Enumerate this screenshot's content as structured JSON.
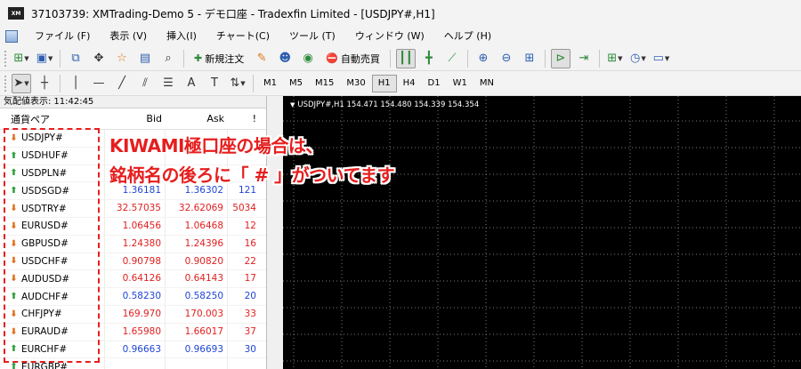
{
  "window": {
    "title": "37103739: XMTrading-Demo 5 - デモ口座 - Tradexfin Limited - [USDJPY#,H1]",
    "logo_text": "XM"
  },
  "menu": [
    "ファイル (F)",
    "表示 (V)",
    "挿入(I)",
    "チャート(C)",
    "ツール (T)",
    "ウィンドウ (W)",
    "ヘルプ (H)"
  ],
  "toolbar": {
    "new_order_label": "新規注文",
    "auto_trading_label": "自動売買",
    "timeframes": [
      "M1",
      "M5",
      "M15",
      "M30",
      "H1",
      "H4",
      "D1",
      "W1",
      "MN"
    ],
    "active_timeframe": "H1"
  },
  "market_watch": {
    "header_label": "気配値表示:",
    "time": "11:42:45",
    "columns": {
      "symbol": "通貨ペア",
      "bid": "Bid",
      "ask": "Ask",
      "spread": "!"
    },
    "rows": [
      {
        "symbol": "USDJPY#",
        "dir": "down",
        "bid": "",
        "ask": "",
        "spread": "",
        "color": "blue"
      },
      {
        "symbol": "USDHUF#",
        "dir": "up",
        "bid": "",
        "ask": "",
        "spread": "",
        "color": "blue"
      },
      {
        "symbol": "USDPLN#",
        "dir": "up",
        "bid": "",
        "ask": "",
        "spread": "",
        "color": "blue"
      },
      {
        "symbol": "USDSGD#",
        "dir": "up",
        "bid": "1.36181",
        "ask": "1.36302",
        "spread": "121",
        "color": "blue"
      },
      {
        "symbol": "USDTRY#",
        "dir": "down",
        "bid": "32.57035",
        "ask": "32.62069",
        "spread": "5034",
        "color": "red"
      },
      {
        "symbol": "EURUSD#",
        "dir": "down",
        "bid": "1.06456",
        "ask": "1.06468",
        "spread": "12",
        "color": "red"
      },
      {
        "symbol": "GBPUSD#",
        "dir": "down",
        "bid": "1.24380",
        "ask": "1.24396",
        "spread": "16",
        "color": "red"
      },
      {
        "symbol": "USDCHF#",
        "dir": "down",
        "bid": "0.90798",
        "ask": "0.90820",
        "spread": "22",
        "color": "red"
      },
      {
        "symbol": "AUDUSD#",
        "dir": "down",
        "bid": "0.64126",
        "ask": "0.64143",
        "spread": "17",
        "color": "red"
      },
      {
        "symbol": "AUDCHF#",
        "dir": "up",
        "bid": "0.58230",
        "ask": "0.58250",
        "spread": "20",
        "color": "blue"
      },
      {
        "symbol": "CHFJPY#",
        "dir": "down",
        "bid": "169.970",
        "ask": "170.003",
        "spread": "33",
        "color": "red"
      },
      {
        "symbol": "EURAUD#",
        "dir": "down",
        "bid": "1.65980",
        "ask": "1.66017",
        "spread": "37",
        "color": "red"
      },
      {
        "symbol": "EURCHF#",
        "dir": "up",
        "bid": "0.96663",
        "ask": "0.96693",
        "spread": "30",
        "color": "blue"
      },
      {
        "symbol": "EURGBP#",
        "dir": "up",
        "bid": "",
        "ask": "",
        "spread": "",
        "color": "blue"
      }
    ]
  },
  "chart": {
    "label": "USDJPY#,H1  154.471 154.480 154.339 154.354"
  },
  "annotation": {
    "line1": "KIWAMI極口座の場合は、",
    "line2": "銘柄名の後ろに「 # 」がついてます"
  },
  "colors": {
    "up": "#2e9e3c",
    "down": "#e0701c",
    "bid_blue": "#1f45d6",
    "bid_red": "#e02020",
    "annotation": "#e61e1e"
  }
}
